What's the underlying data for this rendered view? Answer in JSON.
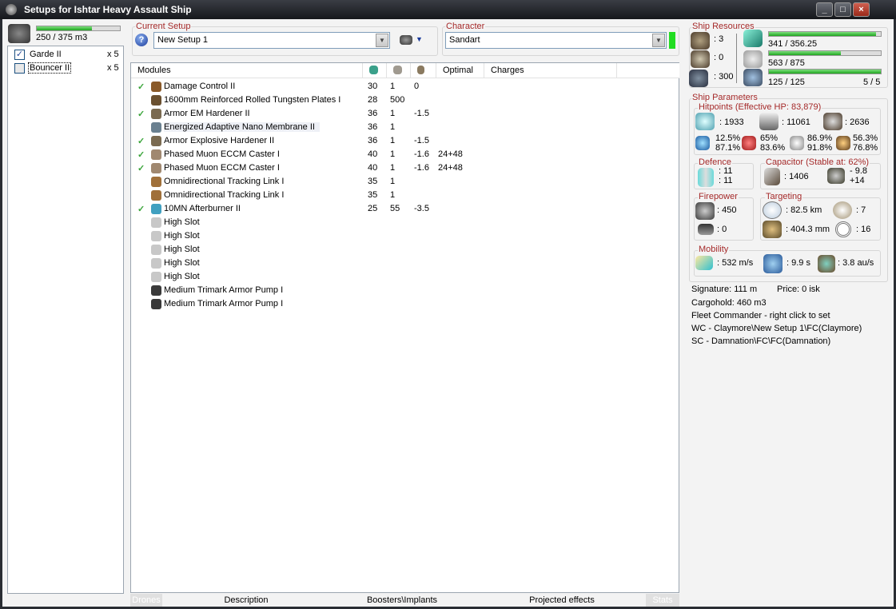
{
  "window": {
    "title": "Setups for Ishtar Heavy Assault Ship",
    "controls": [
      "_",
      "□",
      "×"
    ]
  },
  "drones": {
    "bay": "250 / 375 m3",
    "bay_fill": 0.667,
    "items": [
      {
        "name": "Garde II",
        "qty": "x 5",
        "checked": true
      },
      {
        "name": "Bouncer II",
        "qty": "x 5",
        "checked": false
      }
    ]
  },
  "setup": {
    "label": "Current Setup",
    "value": "New Setup 1",
    "help": "?"
  },
  "character": {
    "label": "Character",
    "value": "Sandart",
    "status_color": "#22dd22"
  },
  "modules": {
    "headers": [
      "Modules",
      "",
      "",
      "",
      "Optimal",
      "Charges"
    ],
    "rows": [
      {
        "active": true,
        "name": "Damage Control II",
        "c1": "30",
        "c2": "1",
        "c3": "0",
        "opt": "",
        "chg": "",
        "icon": "damage-control-icon",
        "color": "#8a5a2a"
      },
      {
        "active": false,
        "name": "1600mm Reinforced Rolled Tungsten Plates I",
        "c1": "28",
        "c2": "500",
        "c3": "",
        "opt": "",
        "chg": "",
        "icon": "armor-plate-icon",
        "color": "#6a5030"
      },
      {
        "active": true,
        "name": "Armor EM Hardener II",
        "c1": "36",
        "c2": "1",
        "c3": "-1.5",
        "opt": "",
        "chg": "",
        "icon": "hardener-icon",
        "color": "#7a6a50"
      },
      {
        "active": false,
        "name": "Energized Adaptive Nano Membrane II",
        "c1": "36",
        "c2": "1",
        "c3": "",
        "opt": "",
        "chg": "",
        "icon": "membrane-icon",
        "color": "#6a8090",
        "selected": true
      },
      {
        "active": true,
        "name": "Armor Explosive Hardener II",
        "c1": "36",
        "c2": "1",
        "c3": "-1.5",
        "opt": "",
        "chg": "",
        "icon": "hardener-icon",
        "color": "#7a6a50"
      },
      {
        "active": true,
        "name": "Phased Muon ECCM Caster I",
        "c1": "40",
        "c2": "1",
        "c3": "-1.6",
        "opt": "24+48",
        "chg": "",
        "icon": "eccm-icon",
        "color": "#a08870"
      },
      {
        "active": true,
        "name": "Phased Muon ECCM Caster I",
        "c1": "40",
        "c2": "1",
        "c3": "-1.6",
        "opt": "24+48",
        "chg": "",
        "icon": "eccm-icon",
        "color": "#a08870"
      },
      {
        "active": false,
        "name": "Omnidirectional Tracking Link I",
        "c1": "35",
        "c2": "1",
        "c3": "",
        "opt": "",
        "chg": "",
        "icon": "tracking-link-icon",
        "color": "#a0703a"
      },
      {
        "active": false,
        "name": "Omnidirectional Tracking Link I",
        "c1": "35",
        "c2": "1",
        "c3": "",
        "opt": "",
        "chg": "",
        "icon": "tracking-link-icon",
        "color": "#a0703a"
      },
      {
        "active": true,
        "name": "10MN Afterburner II",
        "c1": "25",
        "c2": "55",
        "c3": "-3.5",
        "opt": "",
        "chg": "",
        "icon": "afterburner-icon",
        "color": "#40a0c0"
      },
      {
        "active": false,
        "name": "High Slot",
        "c1": "",
        "c2": "",
        "c3": "",
        "opt": "",
        "chg": "",
        "icon": "high-slot-icon",
        "color": "#c8c8c8"
      },
      {
        "active": false,
        "name": "High Slot",
        "c1": "",
        "c2": "",
        "c3": "",
        "opt": "",
        "chg": "",
        "icon": "high-slot-icon",
        "color": "#c8c8c8"
      },
      {
        "active": false,
        "name": "High Slot",
        "c1": "",
        "c2": "",
        "c3": "",
        "opt": "",
        "chg": "",
        "icon": "high-slot-icon",
        "color": "#c8c8c8"
      },
      {
        "active": false,
        "name": "High Slot",
        "c1": "",
        "c2": "",
        "c3": "",
        "opt": "",
        "chg": "",
        "icon": "high-slot-icon",
        "color": "#c8c8c8"
      },
      {
        "active": false,
        "name": "High Slot",
        "c1": "",
        "c2": "",
        "c3": "",
        "opt": "",
        "chg": "",
        "icon": "high-slot-icon",
        "color": "#c8c8c8"
      },
      {
        "active": false,
        "name": "Medium Trimark Armor Pump I",
        "c1": "",
        "c2": "",
        "c3": "",
        "opt": "",
        "chg": "",
        "icon": "rig-icon",
        "color": "#3a3a3a"
      },
      {
        "active": false,
        "name": "Medium Trimark Armor Pump I",
        "c1": "",
        "c2": "",
        "c3": "",
        "opt": "",
        "chg": "",
        "icon": "rig-icon",
        "color": "#3a3a3a"
      }
    ]
  },
  "tabs": [
    "Drones",
    "Description",
    "Boosters\\Implants",
    "Projected effects",
    "Stats"
  ],
  "resources": {
    "label": "Ship Resources",
    "turrets": ": 3",
    "launchers": ": 0",
    "calibration": ": 300",
    "cpu": "341 / 356.25",
    "cpu_fill": 0.957,
    "power": "563 / 875",
    "power_fill": 0.643,
    "drone_bw": "125 / 125",
    "drone_bw_fill": 1.0,
    "drones_active": "5 / 5"
  },
  "params": {
    "label": "Ship Parameters",
    "hp": {
      "label": "Hitpoints (Effective HP: 83,879)",
      "shield": ": 1933",
      "armor": ": 11061",
      "structure": ": 2636",
      "res": [
        {
          "a": "12.5%",
          "b": "87.1%"
        },
        {
          "a": "65%",
          "b": "83.6%"
        },
        {
          "a": "86.9%",
          "b": "91.8%"
        },
        {
          "a": "56.3%",
          "b": "76.8%"
        }
      ]
    },
    "defence": {
      "label": "Defence",
      "a": ": 11",
      "b": ": 11"
    },
    "capacitor": {
      "label": "Capacitor (Stable at: 62%)",
      "cap": ": 1406",
      "a": "- 9.8",
      "b": "+14"
    },
    "firepower": {
      "label": "Firepower",
      "dps": ": 450",
      "volley": ": 0"
    },
    "targeting": {
      "label": "Targeting",
      "range": ": 82.5 km",
      "res": ": 404.3 mm",
      "targets": ": 7",
      "sensor": ": 16"
    },
    "mobility": {
      "label": "Mobility",
      "speed": ": 532 m/s",
      "align": ": 9.9 s",
      "warp": ": 3.8 au/s"
    }
  },
  "info": [
    "Signature: 111 m",
    "Price: 0 isk",
    "Cargohold: 460 m3",
    "Fleet Commander - right click to set",
    "WC - Claymore\\New Setup 1\\FC(Claymore)",
    "SC - Damnation\\FC\\FC(Damnation)"
  ]
}
